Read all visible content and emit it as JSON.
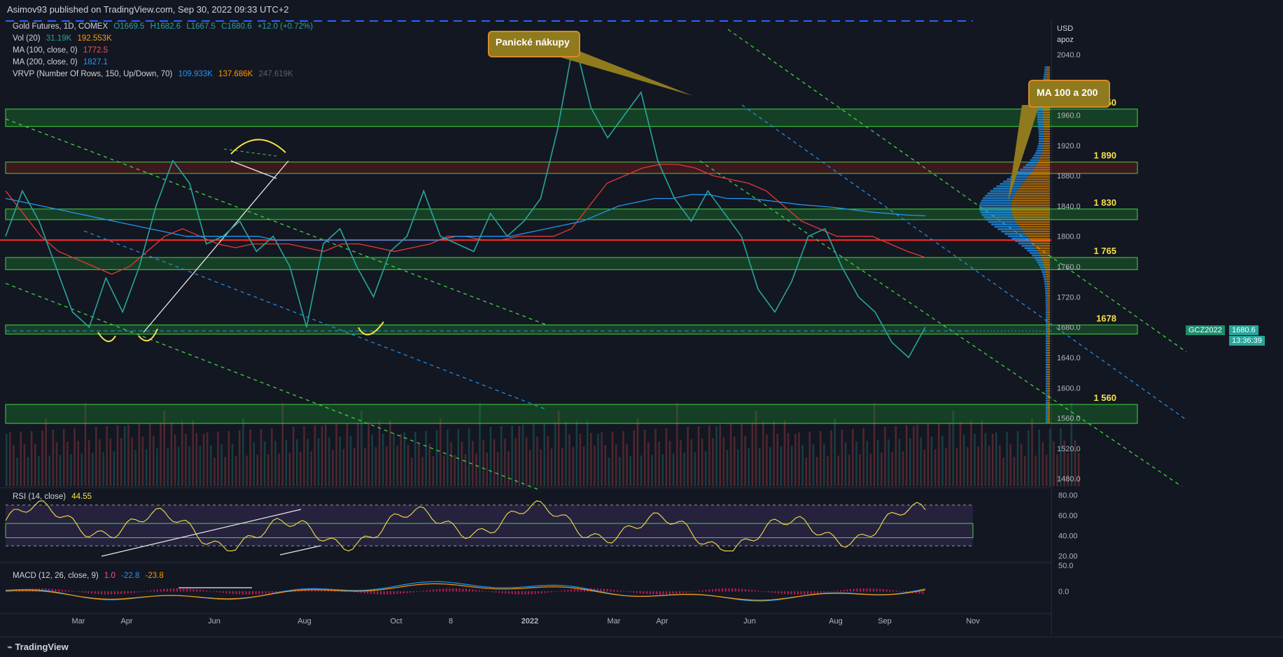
{
  "header": {
    "published": "Asimov93 published on TradingView.com, Sep 30, 2022 09:33 UTC+2"
  },
  "legend": {
    "symbol": "Gold Futures, 1D, COMEX",
    "ohlc": {
      "o": "O1669.5",
      "h": "H1682.6",
      "l": "L1667.5",
      "c": "C1680.6",
      "chg": "+12.0 (+0.72%)"
    },
    "vol_label": "Vol (20)",
    "vol_val1": "31.19K",
    "vol_val2": "192.553K",
    "ma100_label": "MA (100, close, 0)",
    "ma100_val": "1772.5",
    "ma200_label": "MA (200, close, 0)",
    "ma200_val": "1827.1",
    "vrvp_label": "VRVP (Number Of Rows, 150, Up/Down, 70)",
    "vrvp_v1": "109.933K",
    "vrvp_v2": "137.686K",
    "vrvp_v3": "247.619K"
  },
  "axis": {
    "currency": "USD",
    "mode": "apoz",
    "symbol_tag": "GCZ2022",
    "last_price": "1680.6",
    "countdown": "13:36:39"
  },
  "annotations": {
    "panic": "Panické nákupy",
    "ma": "MA 100 a 200"
  },
  "zones": [
    {
      "label": "1 950",
      "low": 1945,
      "high": 1968,
      "color": "#1e8c2e"
    },
    {
      "label": "1 890",
      "low": 1883,
      "high": 1898,
      "color": "#8b1a1a"
    },
    {
      "label": "1 830",
      "low": 1822,
      "high": 1836,
      "color": "#1e8c2e"
    },
    {
      "label": "1 765",
      "low": 1756,
      "high": 1772,
      "color": "#1e8c2e"
    },
    {
      "label": "1678",
      "low": 1671,
      "high": 1683,
      "color": "#1e8c2e"
    },
    {
      "label": "1 560",
      "low": 1553,
      "high": 1578,
      "color": "#1e8c2e"
    }
  ],
  "rsi": {
    "label": "RSI (14, close)",
    "value": "44.55",
    "upper": 70,
    "lower": 30,
    "ticks": [
      "80.00",
      "60.00",
      "40.00",
      "20.00"
    ]
  },
  "macd": {
    "label": "MACD (12, 26, close, 9)",
    "v1": "1.0",
    "v2": "-22.8",
    "v3": "-23.8",
    "ticks": [
      "50.0",
      "0.0"
    ]
  },
  "chart_data": {
    "type": "line",
    "title": "",
    "series": [
      {
        "values": [
          1800,
          1860,
          1820,
          1760,
          1700,
          1680,
          1745,
          1700,
          1760,
          1840,
          1900,
          1870,
          1790,
          1800,
          1820,
          1780,
          1800,
          1760,
          1680,
          1790,
          1810,
          1760,
          1720,
          1780,
          1800,
          1860,
          1800,
          1790,
          1780,
          1830,
          1800,
          1820,
          1850,
          1940,
          2060,
          1970,
          1930,
          1960,
          1990,
          1900,
          1850,
          1820,
          1860,
          1830,
          1800,
          1730,
          1700,
          1740,
          1800,
          1810,
          1760,
          1720,
          1700,
          1660,
          1640,
          1680
        ]
      },
      {
        "name": "MA (100, close, 0)",
        "values": [
          1860,
          1830,
          1800,
          1780,
          1770,
          1760,
          1750,
          1760,
          1780,
          1800,
          1810,
          1800,
          1790,
          1785,
          1790,
          1790,
          1790,
          1785,
          1780,
          1790,
          1790,
          1785,
          1780,
          1785,
          1790,
          1800,
          1800,
          1795,
          1795,
          1800,
          1800,
          1800,
          1810,
          1840,
          1870,
          1880,
          1890,
          1895,
          1895,
          1890,
          1880,
          1875,
          1870,
          1860,
          1840,
          1820,
          1810,
          1800,
          1800,
          1800,
          1790,
          1780,
          1772
        ]
      },
      {
        "name": "MA (200, close, 0)",
        "values": [
          1850,
          1845,
          1840,
          1835,
          1830,
          1825,
          1820,
          1815,
          1810,
          1805,
          1800,
          1800,
          1800,
          1800,
          1800,
          1795,
          1795,
          1795,
          1795,
          1795,
          1795,
          1795,
          1795,
          1795,
          1795,
          1800,
          1800,
          1800,
          1800,
          1805,
          1810,
          1815,
          1820,
          1830,
          1840,
          1845,
          1850,
          1850,
          1855,
          1855,
          1850,
          1850,
          1848,
          1845,
          1842,
          1840,
          1838,
          1835,
          1832,
          1830,
          1828,
          1827
        ]
      }
    ],
    "x_ticks": [
      "Mar",
      "Apr",
      "Jun",
      "Aug",
      "Oct",
      "8",
      "2022",
      "Mar",
      "Apr",
      "Jun",
      "Aug",
      "Sep",
      "Nov"
    ],
    "y_ticks": [
      "2040.0",
      "2000.0",
      "1960.0",
      "1920.0",
      "1880.0",
      "1840.0",
      "1800.0",
      "1760.0",
      "1720.0",
      "1680.0",
      "1640.0",
      "1600.0",
      "1560.0",
      "1520.0",
      "1480.0"
    ],
    "ylim": [
      1470,
      2075
    ],
    "colors": {
      "up": "#26a69a",
      "down": "#ef5350",
      "ma100": "#e53935",
      "ma200": "#2196f3",
      "rsi": "#f5e04a",
      "macd": "#2196f3",
      "signal": "#ff9800"
    }
  }
}
